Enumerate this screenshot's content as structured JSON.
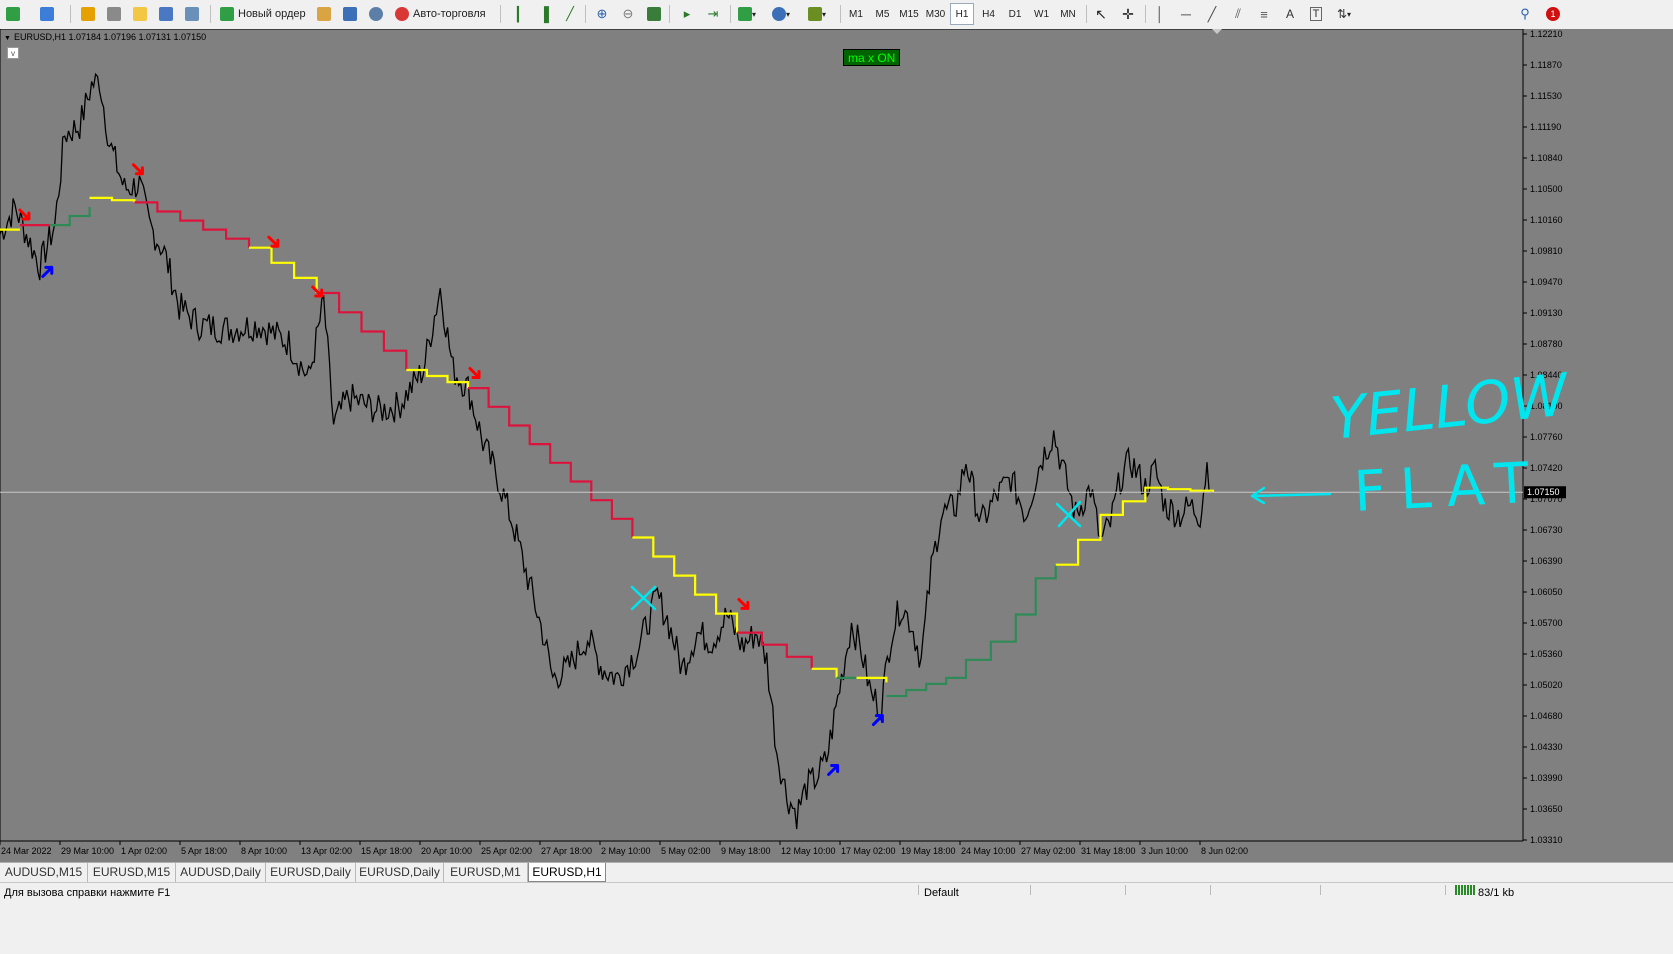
{
  "toolbar": {
    "new_order_label": "Новый ордер",
    "autotrading_label": "Авто-торговля",
    "timeframes": [
      "M1",
      "M5",
      "M15",
      "M30",
      "H1",
      "H4",
      "D1",
      "W1",
      "MN"
    ],
    "active_timeframe": "H1",
    "icons": [
      "new-chart-icon",
      "profiles-icon",
      "market-watch-icon",
      "navigator-icon",
      "data-window-icon",
      "terminal-icon",
      "strategy-tester-icon",
      "new-order-icon",
      "metaeditor-icon",
      "signals-icon",
      "autotrading-icon",
      "bar-chart-icon",
      "candlestick-icon",
      "line-chart-icon",
      "zoom-in-icon",
      "zoom-out-icon",
      "tile-windows-icon",
      "autoscroll-icon",
      "chart-shift-icon",
      "indicators-icon",
      "periods-icon",
      "templates-icon",
      "cursor-icon",
      "crosshair-icon",
      "vertical-line-icon",
      "horizontal-line-icon",
      "trendline-icon",
      "equidistant-channel-icon",
      "fibonacci-icon",
      "text-icon",
      "text-label-icon",
      "arrows-icon",
      "search-icon",
      "notifications-icon"
    ]
  },
  "chart": {
    "header": "EURUSD,H1  1.07184 1.07196 1.07131 1.07150",
    "toggle_label": "v",
    "badge_label": "ma x ON",
    "annotation_yellow": "YELLOW",
    "annotation_flat": "FLAT",
    "colors": {
      "background": "#808080",
      "price": "#000000",
      "ma_down": "#dc143c",
      "ma_flat": "#ffff00",
      "ma_up": "#2e8b57",
      "sell_arrow": "#ff0000",
      "buy_arrow": "#0000ff",
      "handwriting": "#00e5ee"
    }
  },
  "chart_data": {
    "type": "line",
    "symbol": "EURUSD",
    "timeframe": "H1",
    "current_price": "1.07150",
    "y_ticks": [
      "1.12210",
      "1.11870",
      "1.11530",
      "1.11190",
      "1.10840",
      "1.10500",
      "1.10160",
      "1.09810",
      "1.09470",
      "1.09130",
      "1.08780",
      "1.08440",
      "1.08100",
      "1.07760",
      "1.07420",
      "1.07070",
      "1.06730",
      "1.06390",
      "1.06050",
      "1.05700",
      "1.05360",
      "1.05020",
      "1.04680",
      "1.04330",
      "1.03990",
      "1.03650",
      "1.03310"
    ],
    "x_ticks": [
      "24 Mar 2022",
      "29 Mar 10:00",
      "1 Apr 02:00",
      "5 Apr 18:00",
      "8 Apr 10:00",
      "13 Apr 02:00",
      "15 Apr 18:00",
      "20 Apr 10:00",
      "25 Apr 02:00",
      "27 Apr 18:00",
      "2 May 10:00",
      "5 May 02:00",
      "9 May 18:00",
      "12 May 10:00",
      "17 May 02:00",
      "19 May 18:00",
      "24 May 10:00",
      "27 May 02:00",
      "31 May 18:00",
      "3 Jun 10:00",
      "8 Jun 02:00"
    ],
    "ylim": [
      1.0331,
      1.1221
    ],
    "bar_index_range": [
      0,
      1220
    ],
    "price_series": {
      "name": "",
      "points": [
        [
          0,
          1.1
        ],
        [
          15,
          1.103
        ],
        [
          40,
          1.0965
        ],
        [
          55,
          1.101
        ],
        [
          65,
          1.111
        ],
        [
          80,
          1.112
        ],
        [
          92,
          1.1165
        ],
        [
          100,
          1.117
        ],
        [
          110,
          1.11
        ],
        [
          125,
          1.105
        ],
        [
          140,
          1.1055
        ],
        [
          150,
          1.101
        ],
        [
          165,
          1.098
        ],
        [
          180,
          1.092
        ],
        [
          200,
          1.09
        ],
        [
          230,
          1.0895
        ],
        [
          260,
          1.09
        ],
        [
          290,
          1.088
        ],
        [
          310,
          1.084
        ],
        [
          325,
          1.0925
        ],
        [
          335,
          1.079
        ],
        [
          350,
          1.082
        ],
        [
          380,
          1.0805
        ],
        [
          400,
          1.081
        ],
        [
          425,
          1.085
        ],
        [
          442,
          1.094
        ],
        [
          455,
          1.085
        ],
        [
          470,
          1.083
        ],
        [
          485,
          1.077
        ],
        [
          500,
          1.073
        ],
        [
          515,
          1.068
        ],
        [
          530,
          1.062
        ],
        [
          545,
          1.056
        ],
        [
          555,
          1.051
        ],
        [
          570,
          1.052
        ],
        [
          590,
          1.0555
        ],
        [
          605,
          1.052
        ],
        [
          620,
          1.051
        ],
        [
          640,
          1.054
        ],
        [
          660,
          1.06
        ],
        [
          670,
          1.0575
        ],
        [
          685,
          1.052
        ],
        [
          700,
          1.056
        ],
        [
          715,
          1.055
        ],
        [
          730,
          1.058
        ],
        [
          745,
          1.0545
        ],
        [
          760,
          1.056
        ],
        [
          770,
          1.053
        ],
        [
          780,
          1.043
        ],
        [
          790,
          1.038
        ],
        [
          800,
          1.036
        ],
        [
          810,
          1.039
        ],
        [
          820,
          1.04
        ],
        [
          830,
          1.042
        ],
        [
          845,
          1.051
        ],
        [
          855,
          1.057
        ],
        [
          865,
          1.054
        ],
        [
          875,
          1.049
        ],
        [
          885,
          1.048
        ],
        [
          895,
          1.056
        ],
        [
          905,
          1.059
        ],
        [
          915,
          1.057
        ],
        [
          925,
          1.053
        ],
        [
          935,
          1.063
        ],
        [
          945,
          1.069
        ],
        [
          960,
          1.07
        ],
        [
          970,
          1.075
        ],
        [
          985,
          1.068
        ],
        [
          1000,
          1.071
        ],
        [
          1015,
          1.073
        ],
        [
          1030,
          1.069
        ],
        [
          1045,
          1.075
        ],
        [
          1058,
          1.078
        ],
        [
          1070,
          1.073
        ],
        [
          1080,
          1.069
        ],
        [
          1095,
          1.072
        ],
        [
          1105,
          1.066
        ],
        [
          1115,
          1.068
        ],
        [
          1125,
          1.073
        ],
        [
          1135,
          1.075
        ],
        [
          1150,
          1.072
        ],
        [
          1160,
          1.074
        ],
        [
          1170,
          1.07
        ],
        [
          1185,
          1.069
        ],
        [
          1195,
          1.07
        ],
        [
          1205,
          1.069
        ],
        [
          1212,
          1.0745
        ],
        [
          1218,
          1.0715
        ]
      ]
    },
    "ma_series": {
      "name": "",
      "segments": [
        {
          "trend": "flat",
          "points": [
            [
              0,
              1.1005
            ],
            [
              20,
              1.1005
            ]
          ]
        },
        {
          "trend": "down",
          "points": [
            [
              20,
              1.101
            ],
            [
              50,
              1.101
            ]
          ]
        },
        {
          "trend": "up",
          "points": [
            [
              50,
              1.101
            ],
            [
              70,
              1.102
            ],
            [
              90,
              1.103
            ]
          ]
        },
        {
          "trend": "flat",
          "points": [
            [
              90,
              1.104
            ],
            [
              135,
              1.1035
            ]
          ]
        },
        {
          "trend": "down",
          "points": [
            [
              135,
              1.1035
            ],
            [
              250,
              1.0985
            ]
          ]
        },
        {
          "trend": "flat",
          "points": [
            [
              250,
              1.0985
            ],
            [
              318,
              1.0935
            ]
          ]
        },
        {
          "trend": "down",
          "points": [
            [
              318,
              1.0935
            ],
            [
              408,
              1.085
            ]
          ]
        },
        {
          "trend": "flat",
          "points": [
            [
              408,
              1.085
            ],
            [
              470,
              1.083
            ]
          ]
        },
        {
          "trend": "down",
          "points": [
            [
              470,
              1.083
            ],
            [
              635,
              1.0665
            ]
          ]
        },
        {
          "trend": "flat",
          "points": [
            [
              635,
              1.0665
            ],
            [
              740,
              1.056
            ]
          ]
        },
        {
          "trend": "down",
          "points": [
            [
              740,
              1.056
            ],
            [
              815,
              1.052
            ]
          ]
        },
        {
          "trend": "flat",
          "points": [
            [
              815,
              1.052
            ],
            [
              840,
              1.051
            ]
          ]
        },
        {
          "trend": "up",
          "points": [
            [
              840,
              1.051
            ],
            [
              860,
              1.051
            ]
          ]
        },
        {
          "trend": "flat",
          "points": [
            [
              860,
              1.051
            ],
            [
              890,
              1.0505
            ]
          ]
        },
        {
          "trend": "up",
          "points": [
            [
              890,
              1.049
            ],
            [
              950,
              1.051
            ],
            [
              970,
              1.053
            ],
            [
              995,
              1.055
            ],
            [
              1020,
              1.058
            ],
            [
              1040,
              1.062
            ],
            [
              1060,
              1.0635
            ]
          ]
        },
        {
          "trend": "flat",
          "points": [
            [
              1060,
              1.0635
            ],
            [
              1105,
              1.069
            ],
            [
              1150,
              1.072
            ],
            [
              1218,
              1.0715
            ]
          ]
        }
      ]
    },
    "signals": [
      {
        "type": "sell",
        "x": 26,
        "price": 1.102
      },
      {
        "type": "buy",
        "x": 48,
        "price": 1.096
      },
      {
        "type": "sell",
        "x": 140,
        "price": 1.107
      },
      {
        "type": "sell",
        "x": 276,
        "price": 1.099
      },
      {
        "type": "sell",
        "x": 320,
        "price": 1.0935
      },
      {
        "type": "sell",
        "x": 478,
        "price": 1.0845
      },
      {
        "type": "sell",
        "x": 748,
        "price": 1.059
      },
      {
        "type": "buy",
        "x": 837,
        "price": 1.041
      },
      {
        "type": "buy",
        "x": 882,
        "price": 1.0465
      }
    ]
  },
  "tabs": [
    {
      "label": "AUDUSD,M15",
      "active": false
    },
    {
      "label": "EURUSD,M15",
      "active": false
    },
    {
      "label": "AUDUSD,Daily",
      "active": false
    },
    {
      "label": "EURUSD,Daily",
      "active": false
    },
    {
      "label": "EURUSD,Daily",
      "active": false
    },
    {
      "label": "EURUSD,M1",
      "active": false
    },
    {
      "label": "EURUSD,H1",
      "active": true
    }
  ],
  "statusbar": {
    "help": "Для вызова справки нажмите F1",
    "profile": "Default",
    "traffic": "83/1 kb"
  }
}
